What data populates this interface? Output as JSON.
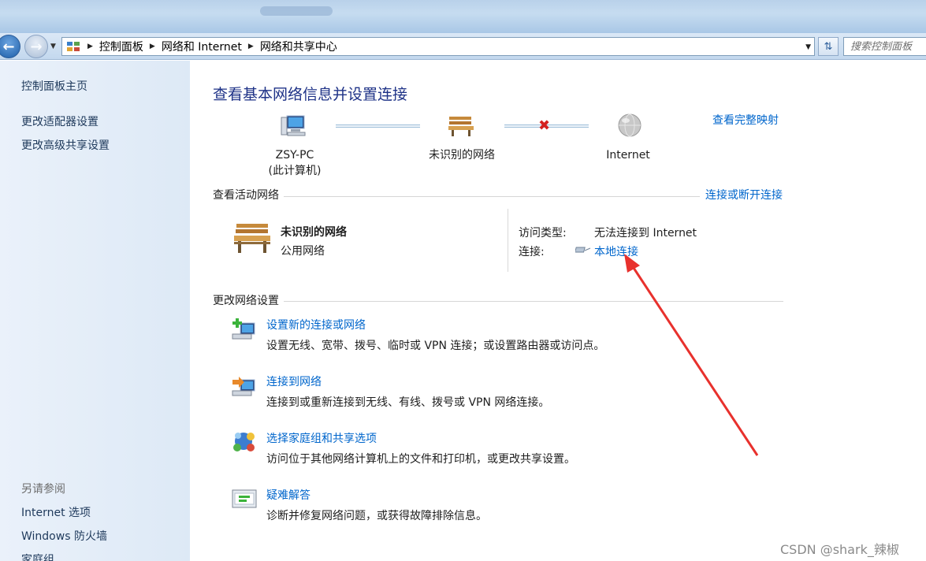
{
  "window": {
    "accent": "#0066cc",
    "heading_color": "#1e3287"
  },
  "breadcrumbs": [
    "控制面板",
    "网络和 Internet",
    "网络和共享中心"
  ],
  "search": {
    "placeholder": "搜索控制面板"
  },
  "left_pane": {
    "links": [
      "控制面板主页",
      "更改适配器设置",
      "更改高级共享设置"
    ],
    "see_also_title": "另请参阅",
    "see_also": [
      "Internet 选项",
      "Windows 防火墙",
      "家庭组"
    ]
  },
  "main": {
    "heading": "查看基本网络信息并设置连接",
    "view_full_map": "查看完整映射",
    "map_nodes": [
      {
        "line1": "ZSY-PC",
        "line2": "(此计算机)"
      },
      {
        "line1": "未识别的网络",
        "line2": ""
      },
      {
        "line1": "Internet",
        "line2": ""
      }
    ],
    "active_networks": {
      "section_title": "查看活动网络",
      "connect_link": "连接或断开连接",
      "network_name": "未识别的网络",
      "network_type": "公用网络",
      "access_type_label": "访问类型:",
      "access_type_value": "无法连接到 Internet",
      "connections_label": "连接:",
      "connection_link": "本地连接"
    },
    "change_settings": {
      "section_title": "更改网络设置",
      "tasks": [
        {
          "title": "设置新的连接或网络",
          "desc": "设置无线、宽带、拨号、临时或 VPN 连接；或设置路由器或访问点。",
          "icon": "new-connection-icon"
        },
        {
          "title": "连接到网络",
          "desc": "连接到或重新连接到无线、有线、拨号或 VPN 网络连接。",
          "icon": "connect-network-icon"
        },
        {
          "title": "选择家庭组和共享选项",
          "desc": "访问位于其他网络计算机上的文件和打印机，或更改共享设置。",
          "icon": "homegroup-icon"
        },
        {
          "title": "疑难解答",
          "desc": "诊断并修复网络问题，或获得故障排除信息。",
          "icon": "troubleshoot-icon"
        }
      ]
    }
  },
  "watermark": "CSDN @shark_辣椒"
}
